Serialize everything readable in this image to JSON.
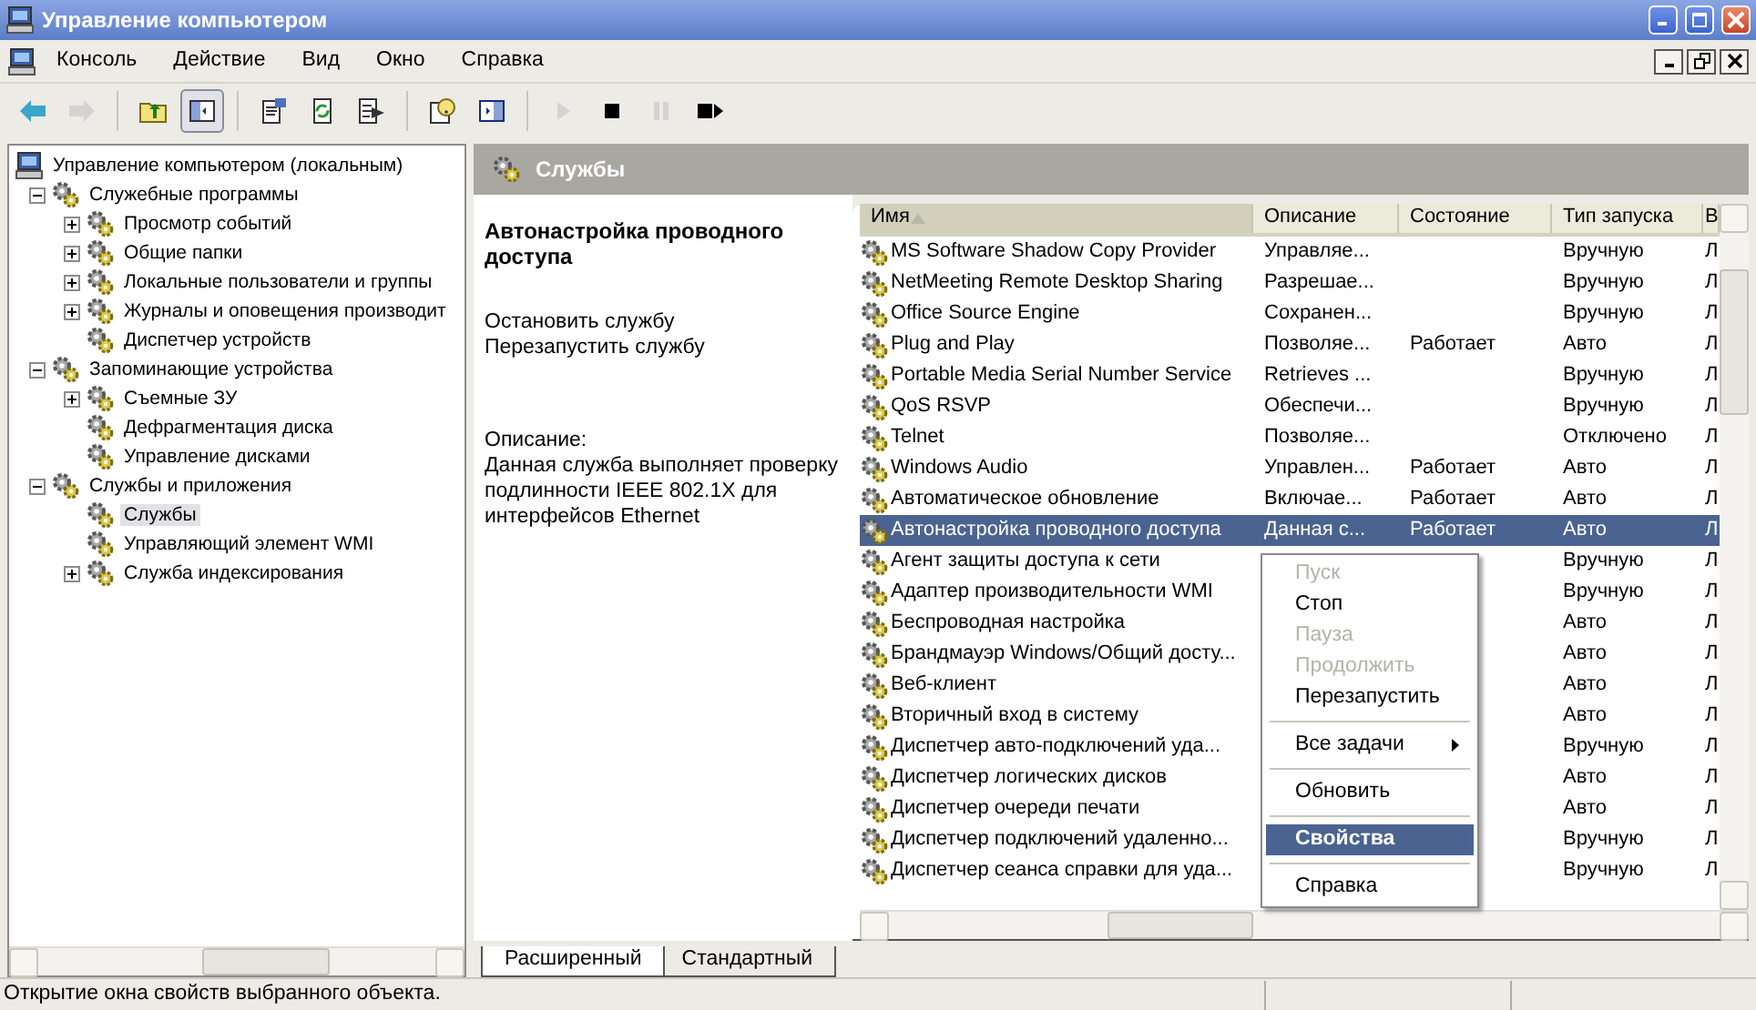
{
  "window": {
    "title": "Управление компьютером"
  },
  "menu_bar": [
    "Консоль",
    "Действие",
    "Вид",
    "Окно",
    "Справка"
  ],
  "toolbar": [
    {
      "kind": "back",
      "disabled": false,
      "pressed": false
    },
    {
      "kind": "forward",
      "disabled": true,
      "pressed": false
    },
    {
      "kind": "separator"
    },
    {
      "kind": "up",
      "disabled": false,
      "pressed": false
    },
    {
      "kind": "tree",
      "disabled": false,
      "pressed": true
    },
    {
      "kind": "separator"
    },
    {
      "kind": "properties",
      "disabled": false,
      "pressed": false
    },
    {
      "kind": "refresh",
      "disabled": false,
      "pressed": false
    },
    {
      "kind": "export",
      "disabled": false,
      "pressed": false
    },
    {
      "kind": "separator"
    },
    {
      "kind": "help",
      "disabled": false,
      "pressed": false
    },
    {
      "kind": "pane",
      "disabled": false,
      "pressed": false
    },
    {
      "kind": "separator"
    },
    {
      "kind": "play",
      "disabled": true,
      "pressed": false
    },
    {
      "kind": "stop",
      "disabled": false,
      "pressed": false
    },
    {
      "kind": "pause",
      "disabled": true,
      "pressed": false
    },
    {
      "kind": "restart",
      "disabled": false,
      "pressed": false
    }
  ],
  "tree": {
    "items": [
      {
        "label": "Управление компьютером (локальным)",
        "selected": false,
        "children": [
          {
            "label": "Служебные программы",
            "expanded": true,
            "selected": false,
            "children": [
              {
                "label": "Просмотр событий",
                "expanded": false,
                "selected": false
              },
              {
                "label": "Общие папки",
                "expanded": false,
                "selected": false
              },
              {
                "label": "Локальные пользователи и группы",
                "expanded": false,
                "selected": false
              },
              {
                "label": "Журналы и оповещения производит",
                "expanded": false,
                "selected": false
              },
              {
                "label": "Диспетчер устройств",
                "selected": false
              }
            ]
          },
          {
            "label": "Запоминающие устройства",
            "expanded": true,
            "selected": false,
            "children": [
              {
                "label": "Съемные ЗУ",
                "expanded": false,
                "selected": false
              },
              {
                "label": "Дефрагментация диска",
                "selected": false
              },
              {
                "label": "Управление дисками",
                "selected": false
              }
            ]
          },
          {
            "label": "Службы и приложения",
            "expanded": true,
            "selected": false,
            "children": [
              {
                "label": "Службы",
                "selected": true
              },
              {
                "label": "Управляющий элемент WMI",
                "selected": false
              },
              {
                "label": "Служба индексирования",
                "expanded": false,
                "selected": false
              }
            ]
          }
        ]
      }
    ]
  },
  "panel": {
    "title": "Службы"
  },
  "details": {
    "title": "Автонастройка проводного доступа",
    "actions": [
      {
        "link": "Остановить",
        "text": "службу"
      },
      {
        "link": "Перезапустить",
        "text": "службу"
      }
    ],
    "description_label": "Описание:",
    "description": "Данная служба выполняет проверку подлинности IEEE 802.1X для интерфейсов Ethernet"
  },
  "table": {
    "columns": [
      {
        "label": "Имя",
        "sorted": true
      },
      {
        "label": "Описание",
        "sorted": false
      },
      {
        "label": "Состояние",
        "sorted": false
      },
      {
        "label": "Тип запуска",
        "sorted": false
      },
      {
        "label": "В",
        "sorted": false
      }
    ],
    "rows": [
      {
        "name": "MS Software Shadow Copy Provider",
        "description": "Управляе...",
        "startup": "Вручную",
        "column_5": "Л",
        "selected": false
      },
      {
        "name": "NetMeeting Remote Desktop Sharing",
        "description": "Разрешае...",
        "startup": "Вручную",
        "column_5": "Л",
        "selected": false
      },
      {
        "name": "Office Source Engine",
        "description": "Сохранен...",
        "startup": "Вручную",
        "column_5": "Л",
        "selected": false
      },
      {
        "name": "Plug and Play",
        "description": "Позволяе...",
        "state": "Работает",
        "startup": "Авто",
        "column_5": "Л",
        "selected": false
      },
      {
        "name": "Portable Media Serial Number Service",
        "description": "Retrieves ...",
        "startup": "Вручную",
        "column_5": "Л",
        "selected": false
      },
      {
        "name": "QoS RSVP",
        "description": "Обеспечи...",
        "startup": "Вручную",
        "column_5": "Л",
        "selected": false
      },
      {
        "name": "Telnet",
        "description": "Позволяе...",
        "startup": "Отключено",
        "column_5": "Л",
        "selected": false
      },
      {
        "name": "Windows Audio",
        "description": "Управлен...",
        "state": "Работает",
        "startup": "Авто",
        "column_5": "Л",
        "selected": false
      },
      {
        "name": "Автоматическое обновление",
        "description": "Включае...",
        "state": "Работает",
        "startup": "Авто",
        "column_5": "Л",
        "selected": false
      },
      {
        "name": "Автонастройка проводного доступа",
        "description": "Данная с...",
        "state": "Работает",
        "startup": "Авто",
        "column_5": "Л",
        "selected": true
      },
      {
        "name": "Агент защиты доступа к сети",
        "startup": "Вручную",
        "column_5": "Л",
        "selected": false
      },
      {
        "name": "Адаптер производительности WMI",
        "startup": "Вручную",
        "column_5": "Л",
        "selected": false
      },
      {
        "name": "Беспроводная настройка",
        "startup": "Авто",
        "column_5": "Л",
        "selected": false
      },
      {
        "name": "Брандмауэр Windows/Общий досту...",
        "startup": "Авто",
        "column_5": "Л",
        "selected": false
      },
      {
        "name": "Веб-клиент",
        "startup": "Авто",
        "column_5": "Л",
        "selected": false
      },
      {
        "name": "Вторичный вход в систему",
        "startup": "Авто",
        "column_5": "Л",
        "selected": false
      },
      {
        "name": "Диспетчер авто-подключений уда...",
        "startup": "Вручную",
        "column_5": "Л",
        "selected": false
      },
      {
        "name": "Диспетчер логических дисков",
        "startup": "Авто",
        "column_5": "Л",
        "selected": false
      },
      {
        "name": "Диспетчер очереди печати",
        "startup": "Авто",
        "column_5": "Л",
        "selected": false
      },
      {
        "name": "Диспетчер подключений удаленно...",
        "startup": "Вручную",
        "column_5": "Л",
        "selected": false
      },
      {
        "name": "Диспетчер сеанса справки для уда...",
        "startup": "Вручную",
        "column_5": "Л",
        "selected": false
      }
    ]
  },
  "context_menu": [
    {
      "kind": "item",
      "label": "Пуск",
      "disabled": true,
      "selected": false,
      "default": false,
      "submenu": false
    },
    {
      "kind": "item",
      "label": "Стоп",
      "disabled": false,
      "selected": false,
      "default": false,
      "submenu": false
    },
    {
      "kind": "item",
      "label": "Пауза",
      "disabled": true,
      "selected": false,
      "default": false,
      "submenu": false
    },
    {
      "kind": "item",
      "label": "Продолжить",
      "disabled": true,
      "selected": false,
      "default": false,
      "submenu": false
    },
    {
      "kind": "item",
      "label": "Перезапустить",
      "disabled": false,
      "selected": false,
      "default": false,
      "submenu": false
    },
    {
      "kind": "separator"
    },
    {
      "kind": "item",
      "label": "Все задачи",
      "disabled": false,
      "selected": false,
      "default": false,
      "submenu": true
    },
    {
      "kind": "separator"
    },
    {
      "kind": "item",
      "label": "Обновить",
      "disabled": false,
      "selected": false,
      "default": false,
      "submenu": false
    },
    {
      "kind": "separator"
    },
    {
      "kind": "item",
      "label": "Свойства",
      "disabled": false,
      "selected": true,
      "default": true,
      "submenu": false
    },
    {
      "kind": "separator"
    },
    {
      "kind": "item",
      "label": "Справка",
      "disabled": false,
      "selected": false,
      "default": false,
      "submenu": false
    }
  ],
  "view_tabs": [
    {
      "label": "Расширенный",
      "selected": true
    },
    {
      "label": "Стандартный",
      "selected": false
    }
  ],
  "status_bar": {
    "text": "Открытие окна свойств выбранного объекта."
  }
}
